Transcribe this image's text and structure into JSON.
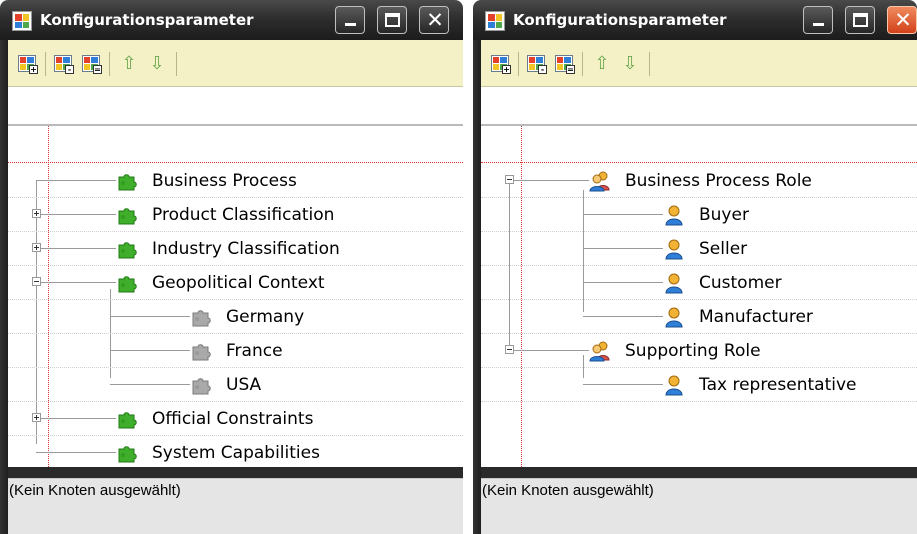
{
  "windows": {
    "left": {
      "title": "Konfigurationsparameter",
      "status_text": "(Kein Knoten ausgewählt)",
      "tree": [
        {
          "label": "Business Process",
          "level": 0,
          "icon": "puzzle-green-icon",
          "expander": "none"
        },
        {
          "label": "Product Classification",
          "level": 0,
          "icon": "puzzle-green-icon",
          "expander": "plus"
        },
        {
          "label": "Industry Classification",
          "level": 0,
          "icon": "puzzle-green-icon",
          "expander": "plus"
        },
        {
          "label": "Geopolitical Context",
          "level": 0,
          "icon": "puzzle-green-icon",
          "expander": "minus"
        },
        {
          "label": "Germany",
          "level": 1,
          "icon": "puzzle-gray-icon",
          "expander": "none"
        },
        {
          "label": "France",
          "level": 1,
          "icon": "puzzle-gray-icon",
          "expander": "none"
        },
        {
          "label": "USA",
          "level": 1,
          "icon": "puzzle-gray-icon",
          "expander": "none"
        },
        {
          "label": "Official Constraints",
          "level": 0,
          "icon": "puzzle-green-icon",
          "expander": "plus"
        },
        {
          "label": "System Capabilities",
          "level": 0,
          "icon": "puzzle-green-icon",
          "expander": "none"
        }
      ]
    },
    "right": {
      "title": "Konfigurationsparameter",
      "status_text": "(Kein Knoten ausgewählt)",
      "tree": [
        {
          "label": "Business Process Role",
          "level": 0,
          "icon": "people-group-icon",
          "expander": "minus"
        },
        {
          "label": "Buyer",
          "level": 1,
          "icon": "person-icon",
          "expander": "none"
        },
        {
          "label": "Seller",
          "level": 1,
          "icon": "person-icon",
          "expander": "none"
        },
        {
          "label": "Customer",
          "level": 1,
          "icon": "person-icon",
          "expander": "none"
        },
        {
          "label": "Manufacturer",
          "level": 1,
          "icon": "person-icon",
          "expander": "none"
        },
        {
          "label": "Supporting Role",
          "level": 0,
          "icon": "people-group-icon",
          "expander": "minus"
        },
        {
          "label": "Tax representative",
          "level": 1,
          "icon": "person-icon",
          "expander": "none"
        }
      ]
    }
  },
  "toolbar": {
    "buttons": [
      "add-node-icon",
      "remove-node-icon",
      "edit-node-icon",
      "move-up-icon",
      "move-down-icon"
    ],
    "arrow_up": "⇧",
    "arrow_down": "⇩"
  },
  "titlebar": {
    "minimize_icon": "minimize-icon",
    "maximize_icon": "maximize-icon",
    "close_icon": "close-icon",
    "close_glyph": "✕"
  },
  "colors": {
    "toolbar_bg": "#f4f1c6",
    "titlebar": "#2e2e2e",
    "close_active": "#d3411a",
    "grid_red": "#dd3333"
  }
}
